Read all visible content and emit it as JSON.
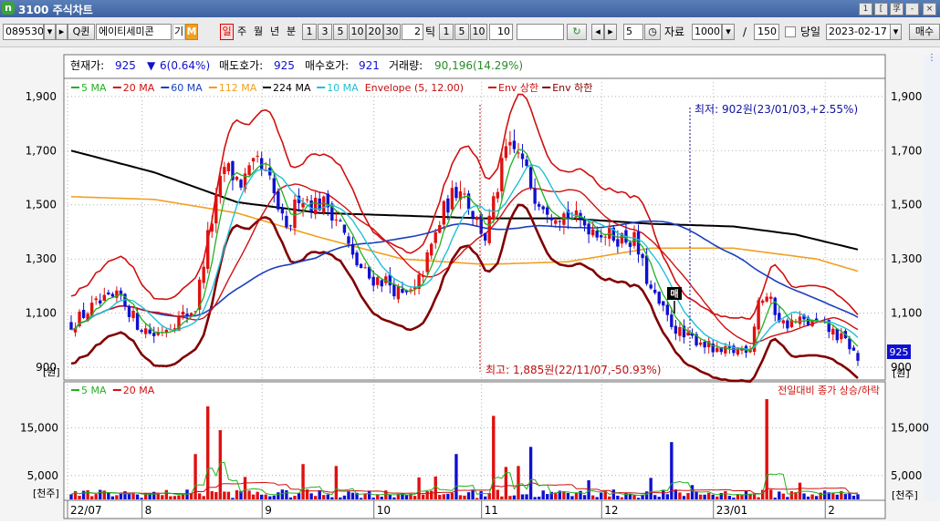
{
  "window": {
    "title": "3100 주식차트",
    "logo": "n",
    "buttons": [
      "1",
      "[",
      "孚",
      "-",
      "□",
      "×"
    ]
  },
  "toolbar": {
    "code": "089530",
    "name": "에이티세미콘",
    "badge1": "기",
    "badge2": "M",
    "search_icon": "Q",
    "search_label": "퀸",
    "period_tabs": [
      "일",
      "주",
      "월",
      "년",
      "분"
    ],
    "minute_options": [
      "1",
      "3",
      "5",
      "10",
      "20",
      "30"
    ],
    "tick_value": "2",
    "tick_label": "틱",
    "tick_options": [
      "1",
      "5",
      "10"
    ],
    "tick_input": "10",
    "count_value": "5",
    "data_label": "자료",
    "data_count": "1000",
    "slash": "/",
    "page_total": "150",
    "day_label": "당일",
    "date": "2023-02-17",
    "buy_sell": "매수"
  },
  "info_bar": {
    "current_price_label": "현재가:",
    "current_price": "925",
    "change": "6(0.64%)",
    "ask_label": "매도호가:",
    "ask": "925",
    "bid_label": "매수호가:",
    "bid": "921",
    "volume_label": "거래량:",
    "volume": "90,196(14.29%)"
  },
  "price_legend": [
    {
      "label": "5 MA",
      "color": "#22b022"
    },
    {
      "label": "20 MA",
      "color": "#d01010"
    },
    {
      "label": "60 MA",
      "color": "#1a3fc0"
    },
    {
      "label": "112 MA",
      "color": "#f0a020"
    },
    {
      "label": "224 MA",
      "color": "#000000"
    },
    {
      "label": "10 MA",
      "color": "#20c0d8"
    },
    {
      "label": "Envelope (5, 12.00)",
      "color": "#c01010"
    },
    {
      "label": "Env 상한",
      "color": "#d01010"
    },
    {
      "label": "Env 하한",
      "color": "#800000"
    }
  ],
  "volume_legend": [
    {
      "label": "5 MA",
      "color": "#22b022"
    },
    {
      "label": "20 MA",
      "color": "#d01010"
    }
  ],
  "volume_note": "전일대비 종가 상승/하락",
  "annotations": {
    "low": "최저: 902원(23/01/03,+2.55%)",
    "high": "최고: 1,885원(22/11/07,-50.93%)",
    "price_tag": "925",
    "marker": "매"
  },
  "price_unit": "[원]",
  "volume_unit": "[천주]",
  "x_labels": [
    "22/07",
    "8",
    "9",
    "10",
    "11",
    "12",
    "23/01",
    "2"
  ],
  "colors": {
    "up": "#e01010",
    "down": "#1010d0",
    "grid": "#b0b0b0",
    "frame": "#707070"
  },
  "chart_data": {
    "type": "candlestick",
    "price_ylim": [
      860,
      1960
    ],
    "price_ticks": [
      900,
      1100,
      1300,
      1500,
      1700,
      1900
    ],
    "price_tick_labels": [
      "900",
      "1,100",
      "1,300",
      "1,500",
      "1,700",
      "1,900"
    ],
    "volume_ylim": [
      0,
      21000
    ],
    "volume_ticks": [
      5000,
      15000
    ],
    "volume_tick_labels": [
      "5,000",
      "15,000"
    ],
    "x_ticks": [
      0,
      18,
      47,
      74,
      100,
      129,
      156,
      183
    ],
    "ma_periods": {
      "ma5": 5,
      "ma10": 10,
      "ma20": 20,
      "ma60": 60
    },
    "env_pct": 0.12,
    "anchors": [
      [
        0,
        1060
      ],
      [
        6,
        1130
      ],
      [
        12,
        1160
      ],
      [
        16,
        1060
      ],
      [
        20,
        1020
      ],
      [
        26,
        1080
      ],
      [
        30,
        1120
      ],
      [
        33,
        1380
      ],
      [
        37,
        1640
      ],
      [
        41,
        1580
      ],
      [
        45,
        1650
      ],
      [
        48,
        1580
      ],
      [
        52,
        1390
      ],
      [
        55,
        1540
      ],
      [
        58,
        1510
      ],
      [
        62,
        1500
      ],
      [
        65,
        1430
      ],
      [
        68,
        1300
      ],
      [
        72,
        1230
      ],
      [
        76,
        1220
      ],
      [
        80,
        1160
      ],
      [
        83,
        1180
      ],
      [
        86,
        1300
      ],
      [
        90,
        1480
      ],
      [
        94,
        1580
      ],
      [
        97,
        1470
      ],
      [
        100,
        1380
      ],
      [
        102,
        1500
      ],
      [
        105,
        1700
      ],
      [
        108,
        1690
      ],
      [
        112,
        1540
      ],
      [
        116,
        1480
      ],
      [
        120,
        1460
      ],
      [
        124,
        1430
      ],
      [
        128,
        1400
      ],
      [
        132,
        1380
      ],
      [
        136,
        1370
      ],
      [
        140,
        1180
      ],
      [
        144,
        1080
      ],
      [
        148,
        1010
      ],
      [
        152,
        1000
      ],
      [
        156,
        950
      ],
      [
        160,
        960
      ],
      [
        164,
        980
      ],
      [
        166,
        1150
      ],
      [
        168,
        1160
      ],
      [
        172,
        1060
      ],
      [
        176,
        1070
      ],
      [
        180,
        1060
      ],
      [
        184,
        1030
      ],
      [
        188,
        980
      ],
      [
        190,
        925
      ]
    ],
    "ma112_anchors": [
      [
        0,
        1530
      ],
      [
        20,
        1520
      ],
      [
        40,
        1470
      ],
      [
        60,
        1380
      ],
      [
        80,
        1300
      ],
      [
        100,
        1280
      ],
      [
        120,
        1290
      ],
      [
        140,
        1340
      ],
      [
        160,
        1340
      ],
      [
        180,
        1300
      ],
      [
        190,
        1255
      ]
    ],
    "ma224_anchors": [
      [
        0,
        1700
      ],
      [
        20,
        1620
      ],
      [
        40,
        1510
      ],
      [
        60,
        1470
      ],
      [
        80,
        1460
      ],
      [
        100,
        1450
      ],
      [
        120,
        1450
      ],
      [
        140,
        1430
      ],
      [
        160,
        1420
      ],
      [
        175,
        1390
      ],
      [
        190,
        1335
      ]
    ],
    "volume_spikes": [
      [
        30,
        9500
      ],
      [
        33,
        19500
      ],
      [
        36,
        14500
      ],
      [
        42,
        4700
      ],
      [
        56,
        7400
      ],
      [
        64,
        7000
      ],
      [
        84,
        4600
      ],
      [
        88,
        4800
      ],
      [
        93,
        9500
      ],
      [
        102,
        17500
      ],
      [
        105,
        6800
      ],
      [
        108,
        7000
      ],
      [
        111,
        11000
      ],
      [
        125,
        4000
      ],
      [
        140,
        4500
      ],
      [
        145,
        12000
      ],
      [
        150,
        3000
      ],
      [
        168,
        21000
      ],
      [
        176,
        3500
      ]
    ],
    "n_candles": 191
  }
}
